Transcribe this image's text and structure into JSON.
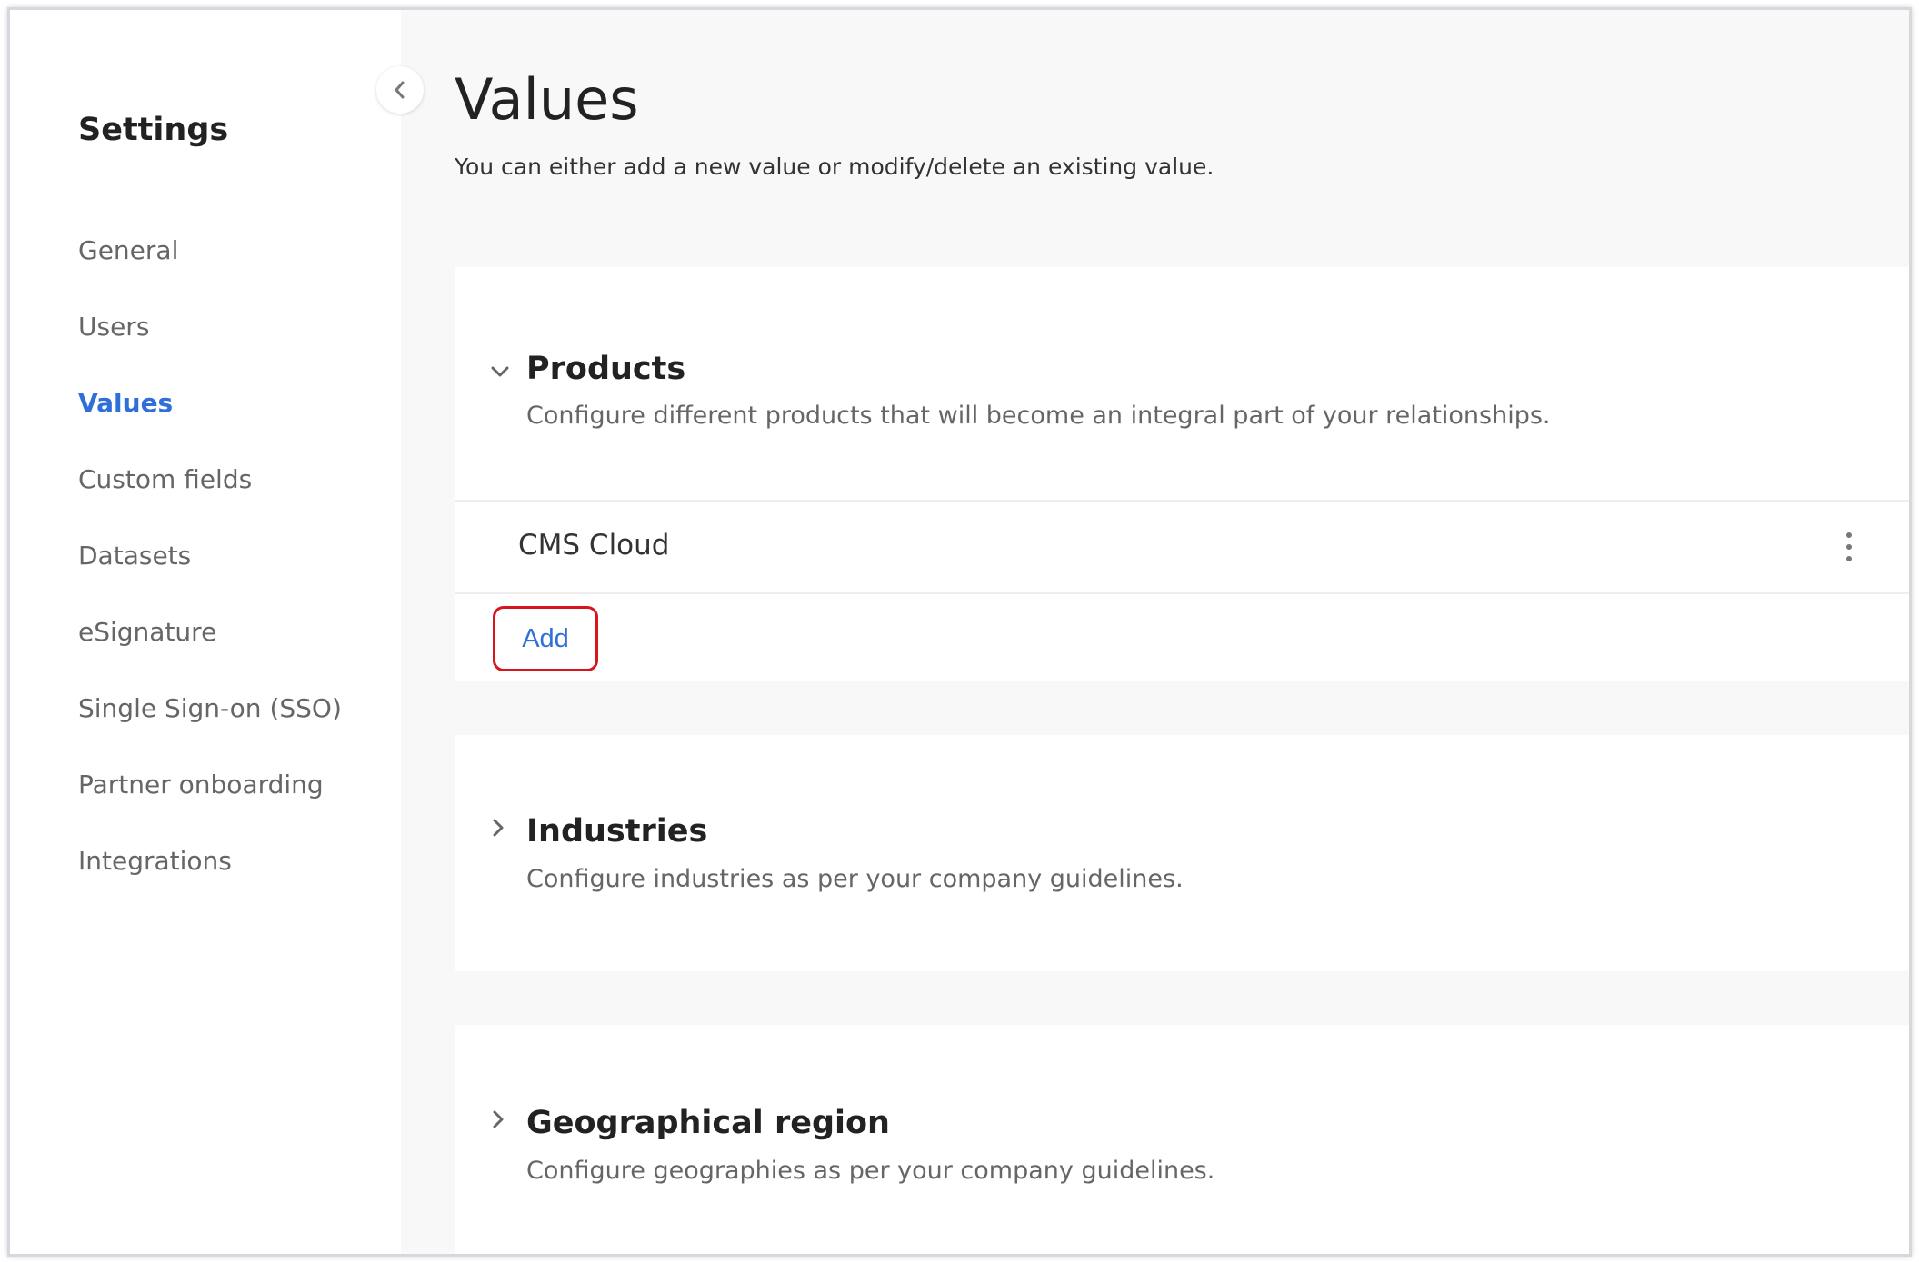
{
  "sidebar": {
    "title": "Settings",
    "items": [
      {
        "label": "General",
        "active": false
      },
      {
        "label": "Users",
        "active": false
      },
      {
        "label": "Values",
        "active": true
      },
      {
        "label": "Custom fields",
        "active": false
      },
      {
        "label": "Datasets",
        "active": false
      },
      {
        "label": "eSignature",
        "active": false
      },
      {
        "label": "Single Sign-on (SSO)",
        "active": false
      },
      {
        "label": "Partner onboarding",
        "active": false
      },
      {
        "label": "Integrations",
        "active": false
      }
    ],
    "collapse_icon": "chevron-left-icon"
  },
  "page": {
    "title": "Values",
    "subtitle": "You can either add a new value or modify/delete an existing value."
  },
  "sections": [
    {
      "title": "Products",
      "description": "Configure different products that will become an integral part of your relationships.",
      "expanded": true,
      "values": [
        "CMS Cloud"
      ],
      "add_label": "Add"
    },
    {
      "title": "Industries",
      "description": "Configure industries as per your company guidelines.",
      "expanded": false
    },
    {
      "title": "Geographical region",
      "description": "Configure geographies as per your company guidelines.",
      "expanded": false
    }
  ],
  "colors": {
    "accent": "#2f6fd8",
    "highlight": "#d8141e",
    "background": "#f8f8f8"
  }
}
